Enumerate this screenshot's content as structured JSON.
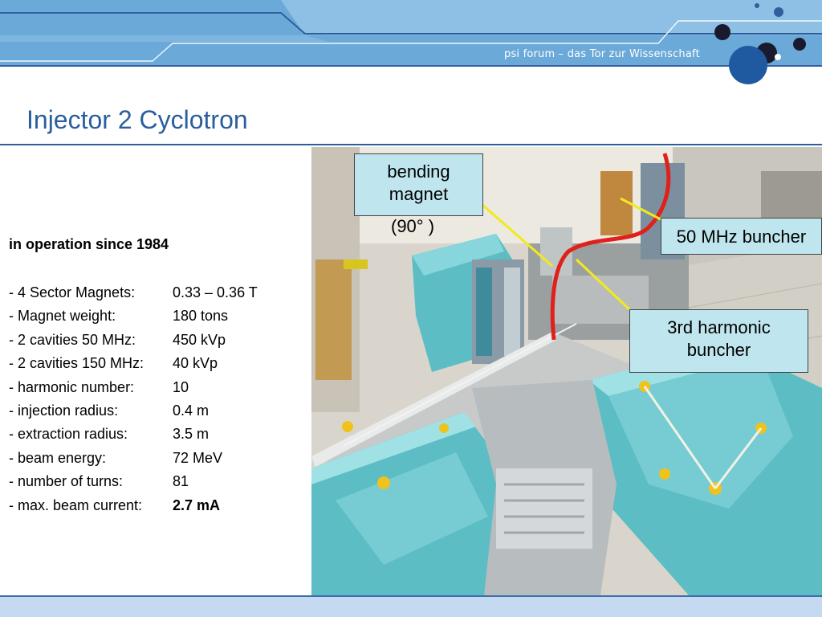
{
  "header": {
    "tagline": "psi forum – das Tor zur Wissenschaft",
    "brand_color": "#2a5e9e",
    "banner_color": "#6aa9d8"
  },
  "slide": {
    "title": "Injector 2 Cyclotron"
  },
  "content": {
    "heading": "in operation since 1984",
    "specs": [
      {
        "label": "- 4 Sector Magnets:",
        "value": "0.33 – 0.36 T"
      },
      {
        "label": "- Magnet weight:",
        "value": "180 tons"
      },
      {
        "label": "- 2 cavities 50 MHz:",
        "value": "450 kVp"
      },
      {
        "label": "- 2 cavities 150 MHz:",
        "value": "40 kVp"
      },
      {
        "label": "- harmonic number:",
        "value": "10"
      },
      {
        "label": "- injection radius:",
        "value": "0.4 m"
      },
      {
        "label": "- extraction radius:",
        "value": "3.5 m"
      },
      {
        "label": "- beam energy:",
        "value": "72 MeV"
      },
      {
        "label": "- number of turns:",
        "value": "81"
      },
      {
        "label": "- max. beam current:",
        "value": "2.7 mA"
      }
    ]
  },
  "photo": {
    "callouts": {
      "bending_line1": "bending",
      "bending_line2": "magnet",
      "bending_line3": "(90°  )",
      "buncher50": "50 MHz buncher",
      "harmonic_line1": "3rd harmonic",
      "harmonic_line2": "buncher"
    },
    "beam_color": "#e0201b",
    "pointer_color": "#f2ea1b"
  }
}
